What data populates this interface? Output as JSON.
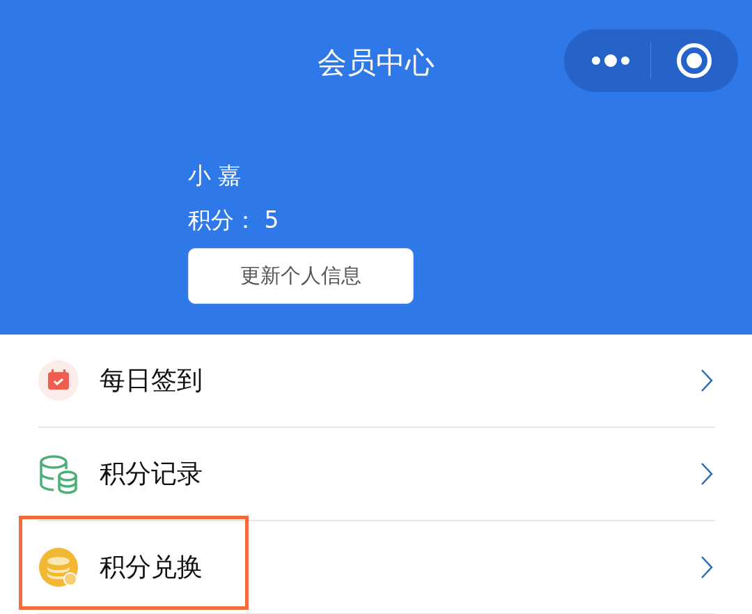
{
  "header": {
    "title": "会员中心"
  },
  "profile": {
    "name": "小 嘉",
    "points": "积分： 5",
    "update_button": "更新个人信息"
  },
  "menu": [
    {
      "kind": "calendar",
      "label": "每日签到",
      "highlighted": false
    },
    {
      "kind": "coins",
      "label": "积分记录",
      "highlighted": false
    },
    {
      "kind": "exchange",
      "label": "积分兑换",
      "highlighted": true
    }
  ]
}
